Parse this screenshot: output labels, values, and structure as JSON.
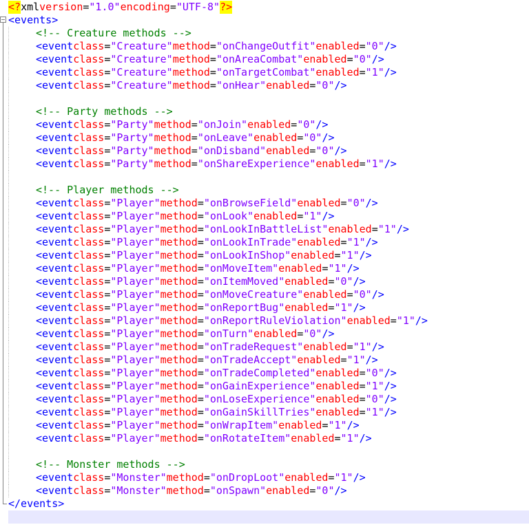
{
  "editor": {
    "declaration": {
      "open": "<?",
      "name": "xml",
      "attrs": [
        {
          "name": "version",
          "value": "\"1.0\""
        },
        {
          "name": "encoding",
          "value": "\"UTF-8\""
        }
      ],
      "close": "?>"
    },
    "root_open": "<events>",
    "root_close": "</events>",
    "groups": [
      {
        "comment": "<!-- Creature methods -->",
        "events": [
          {
            "class": "\"Creature\"",
            "method": "\"onChangeOutfit\"",
            "enabled": "\"0\""
          },
          {
            "class": "\"Creature\"",
            "method": "\"onAreaCombat\"",
            "enabled": "\"0\""
          },
          {
            "class": "\"Creature\"",
            "method": "\"onTargetCombat\"",
            "enabled": "\"1\""
          },
          {
            "class": "\"Creature\"",
            "method": "\"onHear\"",
            "enabled": "\"0\""
          }
        ]
      },
      {
        "comment": "<!-- Party methods -->",
        "events": [
          {
            "class": "\"Party\"",
            "method": "\"onJoin\"",
            "enabled": "\"0\""
          },
          {
            "class": "\"Party\"",
            "method": "\"onLeave\"",
            "enabled": "\"0\""
          },
          {
            "class": "\"Party\"",
            "method": "\"onDisband\"",
            "enabled": "\"0\""
          },
          {
            "class": "\"Party\"",
            "method": "\"onShareExperience\"",
            "enabled": "\"1\""
          }
        ]
      },
      {
        "comment": "<!-- Player methods -->",
        "events": [
          {
            "class": "\"Player\"",
            "method": "\"onBrowseField\"",
            "enabled": "\"0\""
          },
          {
            "class": "\"Player\"",
            "method": "\"onLook\"",
            "enabled": "\"1\""
          },
          {
            "class": "\"Player\"",
            "method": "\"onLookInBattleList\"",
            "enabled": "\"1\""
          },
          {
            "class": "\"Player\"",
            "method": "\"onLookInTrade\"",
            "enabled": "\"1\""
          },
          {
            "class": "\"Player\"",
            "method": "\"onLookInShop\"",
            "enabled": "\"1\""
          },
          {
            "class": "\"Player\"",
            "method": "\"onMoveItem\"",
            "enabled": "\"1\""
          },
          {
            "class": "\"Player\"",
            "method": "\"onItemMoved\"",
            "enabled": "\"0\""
          },
          {
            "class": "\"Player\"",
            "method": "\"onMoveCreature\"",
            "enabled": "\"0\""
          },
          {
            "class": "\"Player\"",
            "method": "\"onReportBug\"",
            "enabled": "\"1\""
          },
          {
            "class": "\"Player\"",
            "method": "\"onReportRuleViolation\"",
            "enabled": "\"1\""
          },
          {
            "class": "\"Player\"",
            "method": "\"onTurn\"",
            "enabled": "\"0\""
          },
          {
            "class": "\"Player\"",
            "method": "\"onTradeRequest\"",
            "enabled": "\"1\""
          },
          {
            "class": "\"Player\"",
            "method": "\"onTradeAccept\"",
            "enabled": "\"1\""
          },
          {
            "class": "\"Player\"",
            "method": "\"onTradeCompleted\"",
            "enabled": "\"0\""
          },
          {
            "class": "\"Player\"",
            "method": "\"onGainExperience\"",
            "enabled": "\"1\""
          },
          {
            "class": "\"Player\"",
            "method": "\"onLoseExperience\"",
            "enabled": "\"0\""
          },
          {
            "class": "\"Player\"",
            "method": "\"onGainSkillTries\"",
            "enabled": "\"1\""
          },
          {
            "class": "\"Player\"",
            "method": "\"onWrapItem\"",
            "enabled": "\"1\""
          },
          {
            "class": "\"Player\"",
            "method": "\"onRotateItem\"",
            "enabled": "\"1\""
          }
        ]
      },
      {
        "comment": "<!-- Monster methods -->",
        "events": [
          {
            "class": "\"Monster\"",
            "method": "\"onDropLoot\"",
            "enabled": "\"1\""
          },
          {
            "class": "\"Monster\"",
            "method": "\"onSpawn\"",
            "enabled": "\"0\""
          }
        ]
      }
    ],
    "tokens": {
      "event_open": "<event",
      "attr_class": "class",
      "attr_method": "method",
      "attr_enabled": "enabled",
      "equals": "=",
      "self_close": "/>"
    }
  },
  "colors": {
    "tag": "#0000ff",
    "attribute": "#ff0000",
    "value": "#8000ff",
    "comment": "#008000",
    "declaration_highlight": "#ffff00",
    "current_line": "#e8e8ff"
  }
}
